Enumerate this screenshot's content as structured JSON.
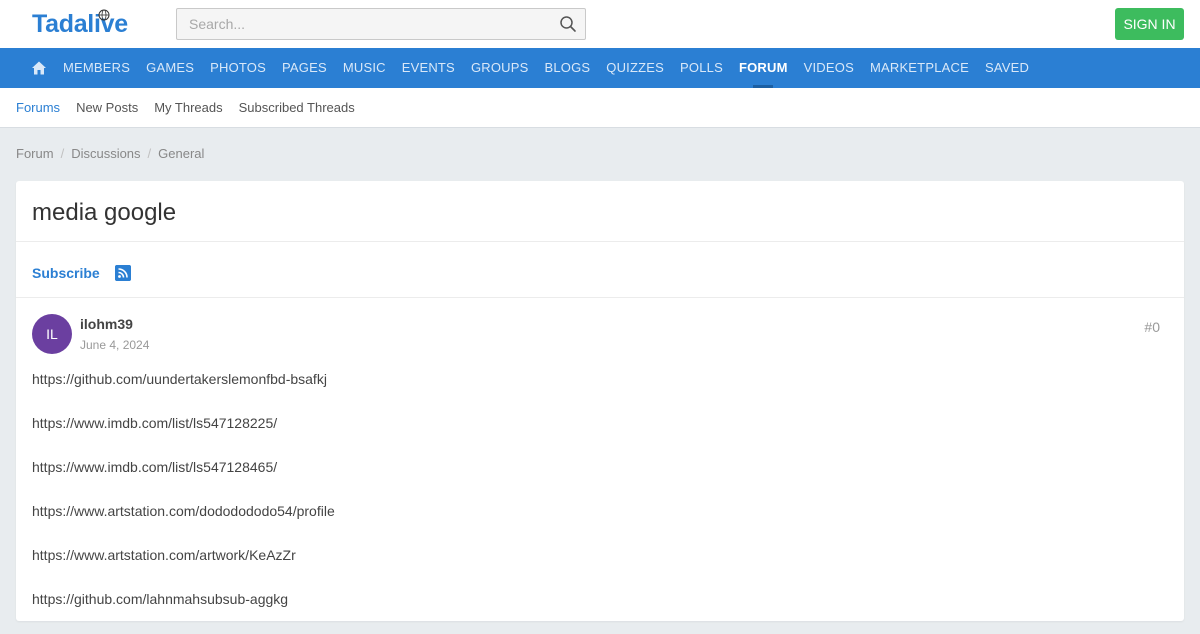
{
  "brand": {
    "name": "Tadalive",
    "color": "#2b7fd3"
  },
  "search": {
    "placeholder": "Search...",
    "value": "",
    "icon": "magnifier-icon"
  },
  "header": {
    "signin_label": "SIGN IN"
  },
  "nav": {
    "home_icon": "home-icon",
    "items": [
      {
        "label": "MEMBERS"
      },
      {
        "label": "GAMES"
      },
      {
        "label": "PHOTOS"
      },
      {
        "label": "PAGES"
      },
      {
        "label": "MUSIC"
      },
      {
        "label": "EVENTS"
      },
      {
        "label": "GROUPS"
      },
      {
        "label": "BLOGS"
      },
      {
        "label": "QUIZZES"
      },
      {
        "label": "POLLS"
      },
      {
        "label": "FORUM",
        "active": true
      },
      {
        "label": "VIDEOS"
      },
      {
        "label": "MARKETPLACE"
      },
      {
        "label": "SAVED"
      }
    ]
  },
  "subnav": {
    "items": [
      {
        "label": "Forums",
        "active": true
      },
      {
        "label": "New Posts"
      },
      {
        "label": "My Threads"
      },
      {
        "label": "Subscribed Threads"
      }
    ]
  },
  "breadcrumb": {
    "items": [
      {
        "label": "Forum"
      },
      {
        "label": "Discussions"
      },
      {
        "label": "General"
      }
    ]
  },
  "thread": {
    "title": "media google",
    "subscribe_label": "Subscribe",
    "rss_icon": "rss-icon"
  },
  "post": {
    "avatar_initials": "IL",
    "avatar_color": "#6b3fa0",
    "author": "ilohm39",
    "date": "June 4, 2024",
    "number": "#0",
    "links": [
      "https://github.com/uundertakerslemonfbd-bsafkj",
      "https://www.imdb.com/list/ls547128225/",
      "https://www.imdb.com/list/ls547128465/",
      "https://www.artstation.com/dododododo54/profile",
      "https://www.artstation.com/artwork/KeAzZr",
      "https://github.com/lahnmahsubsub-aggkg"
    ]
  }
}
